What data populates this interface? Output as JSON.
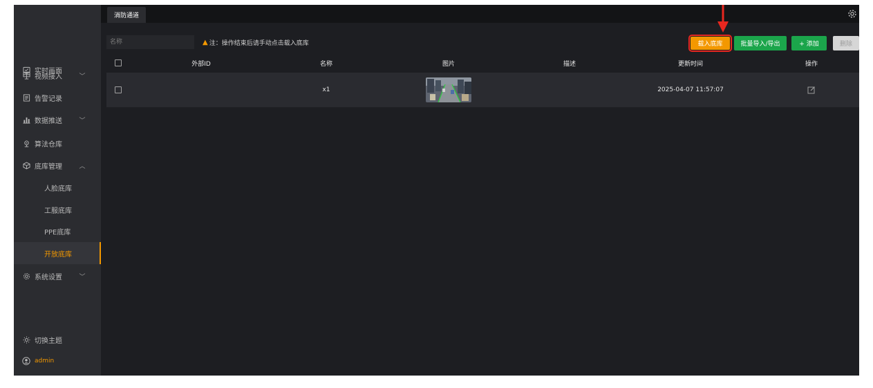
{
  "tab": {
    "label": "消防通道"
  },
  "sidebar": {
    "items": [
      {
        "label": "实时画面",
        "icon": "monitor-icon"
      },
      {
        "label": "视频接入",
        "icon": "video-input-icon",
        "chevron": "down"
      },
      {
        "label": "告警记录",
        "icon": "list-icon"
      },
      {
        "label": "数据推送",
        "icon": "chart-icon",
        "chevron": "down"
      },
      {
        "label": "算法仓库",
        "icon": "algorithm-icon"
      },
      {
        "label": "底库管理",
        "icon": "cube-icon",
        "chevron": "up"
      },
      {
        "label": "系统设置",
        "icon": "gear-icon",
        "chevron": "down"
      }
    ],
    "sub_items": [
      "人脸底库",
      "工服底库",
      "PPE底库",
      "开放底库"
    ],
    "active_sub": "开放底库",
    "theme_label": "切换主题",
    "user_label": "admin"
  },
  "toolbar": {
    "search_placeholder": "名称",
    "notice": "注：操作结束后请手动点击载入底库",
    "load_label": "载入底库",
    "batch_label": "批量导入/导出",
    "add_label": "+ 添加",
    "delete_label": "删除"
  },
  "table": {
    "headers": [
      "外部ID",
      "名称",
      "图片",
      "描述",
      "更新时间",
      "操作"
    ],
    "rows": [
      {
        "external_id": "",
        "name": "x1",
        "description": "",
        "updated": "2025-04-07 11:57:07"
      }
    ]
  },
  "colors": {
    "accent": "#f39800",
    "green": "#1ba54b",
    "highlight": "#e8271f",
    "bg": "#1d1e22",
    "sidebar": "#2b2c30"
  }
}
